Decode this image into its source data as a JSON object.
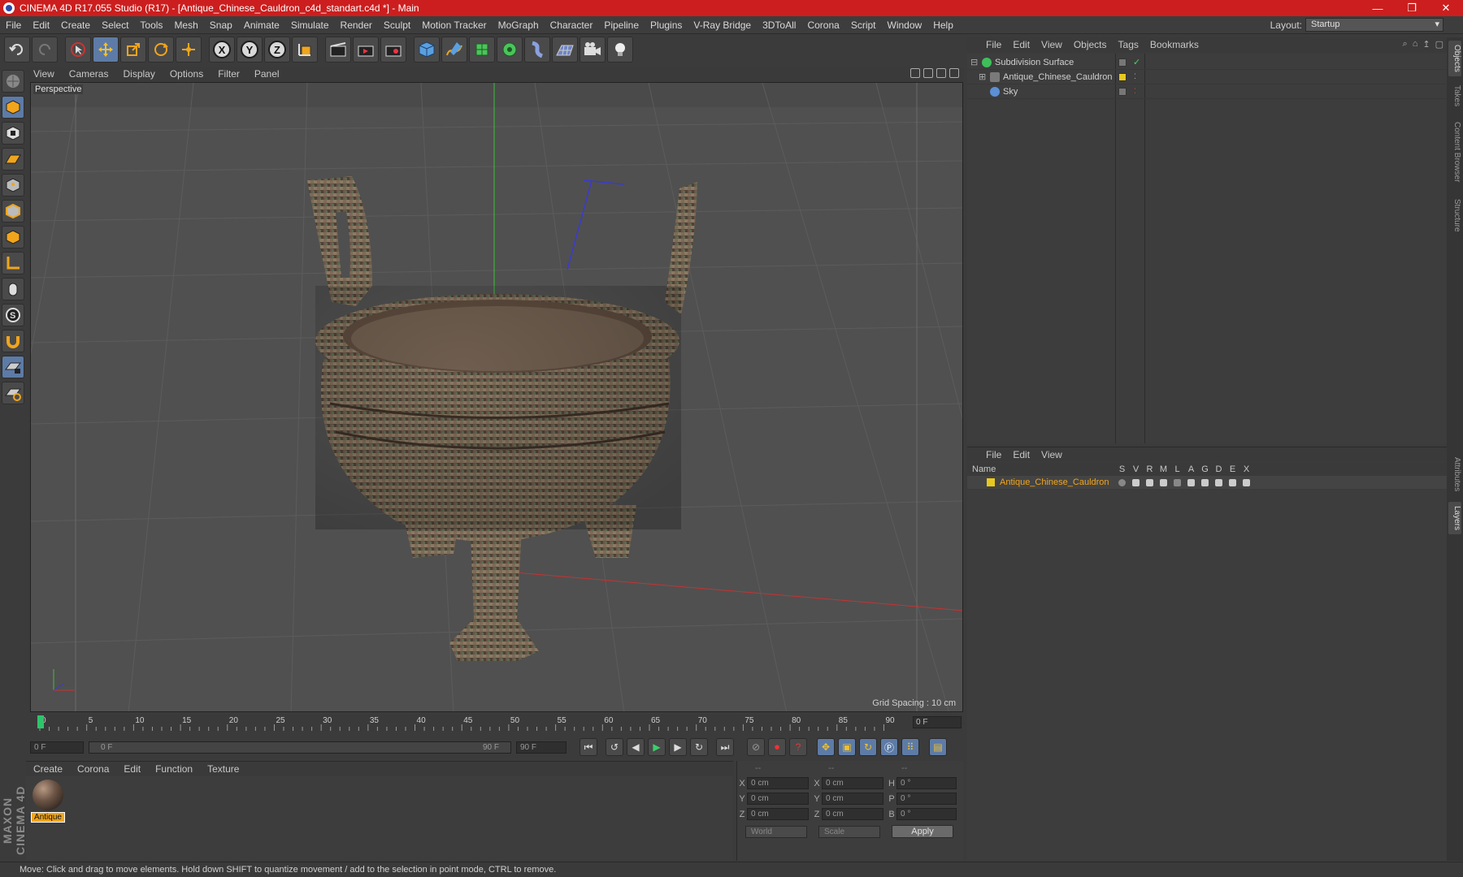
{
  "window": {
    "title": "CINEMA 4D R17.055 Studio (R17) - [Antique_Chinese_Cauldron_c4d_standart.c4d *] - Main",
    "controls": [
      "—",
      "❐",
      "✕"
    ]
  },
  "menubar": {
    "items": [
      "File",
      "Edit",
      "Create",
      "Select",
      "Tools",
      "Mesh",
      "Snap",
      "Animate",
      "Simulate",
      "Render",
      "Sculpt",
      "Motion Tracker",
      "MoGraph",
      "Character",
      "Pipeline",
      "Plugins",
      "V-Ray Bridge",
      "3DToAll",
      "Corona",
      "Script",
      "Window",
      "Help"
    ],
    "layout_label": "Layout:",
    "layout_value": "Startup"
  },
  "toolbar": {
    "axes": [
      "X",
      "Y",
      "Z"
    ]
  },
  "viewport": {
    "menus": [
      "View",
      "Cameras",
      "Display",
      "Options",
      "Filter",
      "Panel"
    ],
    "camera_label": "Perspective",
    "grid_spacing": "Grid Spacing : 10 cm"
  },
  "timeline": {
    "ticks": [
      "0",
      "5",
      "10",
      "15",
      "20",
      "25",
      "30",
      "35",
      "40",
      "45",
      "50",
      "55",
      "60",
      "65",
      "70",
      "75",
      "80",
      "85",
      "90"
    ],
    "end_frame_field": "0 F"
  },
  "transport": {
    "start_field": "0 F",
    "slider_left": "0 F",
    "slider_right": "90 F",
    "end_field": "90 F"
  },
  "material_manager": {
    "menus": [
      "Create",
      "Corona",
      "Edit",
      "Function",
      "Texture"
    ],
    "material_name": "Antique"
  },
  "coordinates": {
    "header": [
      "--",
      "--",
      "--"
    ],
    "rows": [
      {
        "k1": "X",
        "v1": "0 cm",
        "k2": "X",
        "v2": "0 cm",
        "k3": "H",
        "v3": "0 °"
      },
      {
        "k1": "Y",
        "v1": "0 cm",
        "k2": "Y",
        "v2": "0 cm",
        "k3": "P",
        "v3": "0 °"
      },
      {
        "k1": "Z",
        "v1": "0 cm",
        "k2": "Z",
        "v2": "0 cm",
        "k3": "B",
        "v3": "0 °"
      }
    ],
    "mode_select": "World",
    "scale_select": "Scale",
    "apply_label": "Apply"
  },
  "object_manager": {
    "menus": [
      "File",
      "Edit",
      "View",
      "Objects",
      "Tags",
      "Bookmarks"
    ],
    "objects": [
      {
        "name": "Subdivision Surface",
        "icon_color": "#3fbf5a"
      },
      {
        "name": "Antique_Chinese_Cauldron",
        "icon_color": "#7a7a7a"
      },
      {
        "name": "Sky",
        "icon_color": "#5b8fd6"
      }
    ]
  },
  "layer_manager": {
    "menus": [
      "File",
      "Edit",
      "View"
    ],
    "columns": [
      "Name",
      "S",
      "V",
      "R",
      "M",
      "L",
      "A",
      "G",
      "D",
      "E",
      "X"
    ],
    "layer_name": "Antique_Chinese_Cauldron",
    "layer_color": "#e8c81e"
  },
  "right_tabs": [
    "Objects",
    "Takes",
    "Content Browser",
    "Structure",
    "Attributes",
    "Layers"
  ],
  "maxon_logo": "MAXON CINEMA 4D",
  "status": {
    "text": "Move: Click and drag to move elements. Hold down SHIFT to quantize movement / add to the selection in point mode, CTRL to remove."
  },
  "colors": {
    "titlebar": "#cc1e1e",
    "accent_orange": "#f0a51c",
    "active_blue": "#5d7ba6"
  }
}
